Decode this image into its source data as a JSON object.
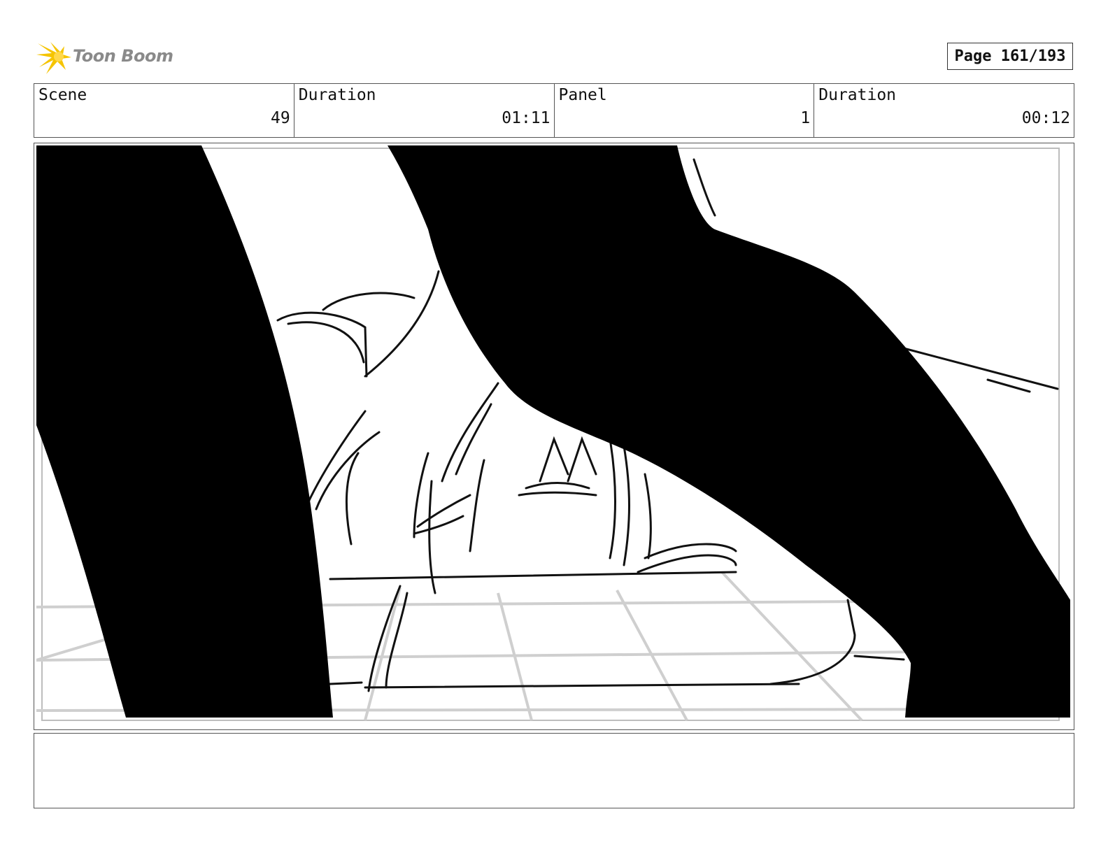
{
  "header": {
    "logo_text": "Toon Boom",
    "page_indicator": "Page 161/193"
  },
  "info": {
    "scene_label": "Scene",
    "scene_value": "49",
    "scene_duration_label": "Duration",
    "scene_duration_value": "01:11",
    "panel_label": "Panel",
    "panel_value": "1",
    "panel_duration_label": "Duration",
    "panel_duration_value": "00:12"
  },
  "panel": {
    "image_icon": "storyboard-sketch",
    "fill_color": "#000000",
    "grid_color": "#cfcfcf"
  },
  "notes": {
    "text": ""
  },
  "colors": {
    "logo_accent": "#f5c400",
    "logo_text": "#8a8a8a"
  }
}
